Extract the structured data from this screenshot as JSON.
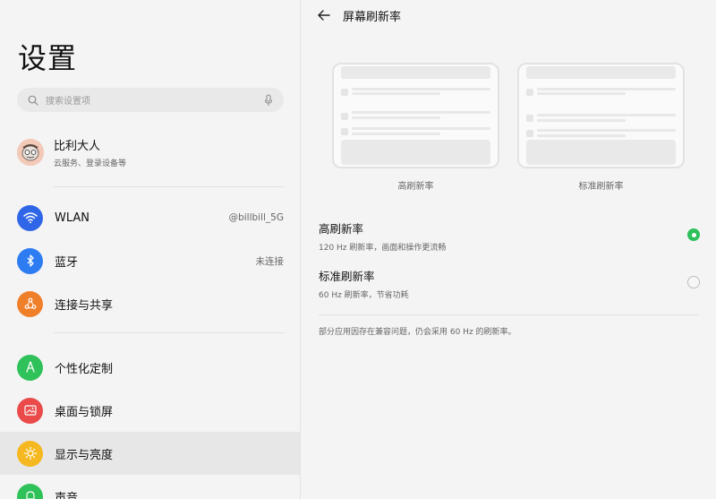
{
  "left": {
    "title": "设置",
    "search": {
      "placeholder": "搜索设置项"
    },
    "account": {
      "name": "比利大人",
      "sub": "云服务、登录设备等"
    },
    "items": [
      {
        "id": "wlan",
        "label": "WLAN",
        "value": "@billbill_5G",
        "icon": "wifi-icon",
        "color": "#2f66e8"
      },
      {
        "id": "bluetooth",
        "label": "蓝牙",
        "value": "未连接",
        "icon": "bluetooth-icon",
        "color": "#2d7cf2"
      },
      {
        "id": "share",
        "label": "连接与共享",
        "value": "",
        "icon": "share-icon",
        "color": "#f07f2a"
      },
      {
        "id": "personalize",
        "label": "个性化定制",
        "value": "",
        "icon": "brush-icon",
        "color": "#2fc15a"
      },
      {
        "id": "desktop",
        "label": "桌面与锁屏",
        "value": "",
        "icon": "image-icon",
        "color": "#ea4a4a"
      },
      {
        "id": "display",
        "label": "显示与亮度",
        "value": "",
        "icon": "sun-icon",
        "color": "#f5b820"
      },
      {
        "id": "sound",
        "label": "声音",
        "value": "",
        "icon": "bell-icon",
        "color": "#2fc15a"
      }
    ]
  },
  "right": {
    "title": "屏幕刷新率",
    "previews": [
      {
        "label": "高刷新率"
      },
      {
        "label": "标准刷新率"
      }
    ],
    "options": [
      {
        "title": "高刷新率",
        "sub": "120 Hz 刷新率，画面和操作更流畅",
        "checked": true
      },
      {
        "title": "标准刷新率",
        "sub": "60 Hz 刷新率，节省功耗",
        "checked": false
      }
    ],
    "note": "部分应用因存在兼容问题，仍会采用 60 Hz 的刷新率。"
  }
}
